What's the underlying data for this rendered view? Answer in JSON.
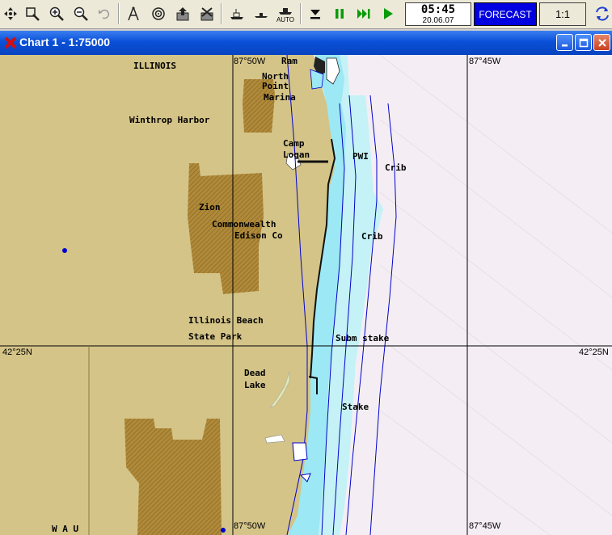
{
  "toolbar": {
    "tools": [
      {
        "icon": "move-icon"
      },
      {
        "icon": "zoom-window-icon"
      },
      {
        "icon": "zoom-in-icon"
      },
      {
        "icon": "zoom-out-icon"
      },
      {
        "icon": "undo-icon"
      },
      {
        "icon": "compass-icon"
      },
      {
        "icon": "target-icon"
      },
      {
        "icon": "export-icon"
      },
      {
        "icon": "clear-icon"
      },
      {
        "icon": "ship-dock-icon"
      },
      {
        "icon": "ship-icon"
      },
      {
        "icon": "auto-ship-icon",
        "label": "AUTO"
      },
      {
        "icon": "download-icon"
      },
      {
        "icon": "pause-icon"
      },
      {
        "icon": "fast-forward-icon"
      },
      {
        "icon": "play-icon"
      }
    ],
    "clock_time": "05:45",
    "clock_date": "20.06.07",
    "forecast_label": "FORECAST",
    "scale_label": "1:1",
    "sync_icon": "sync-icon"
  },
  "window": {
    "title": "Chart 1 - 1:75000",
    "icon": "app-logo-icon",
    "buttons": [
      "minimize-icon",
      "maximize-icon",
      "close-icon"
    ]
  },
  "chart": {
    "colors": {
      "land": "#d4c488",
      "urban": "#b08a3a",
      "shallow": "#9ce8f4",
      "medium": "#c4f2f6",
      "deep": "#f4eef4",
      "grid": "#000000",
      "depth_contour": "#0000cc"
    },
    "coords": {
      "lon_top_left": "87°50W",
      "lon_top_right": "87°45W",
      "lat_left": "42°25N",
      "lat_right": "42°25N",
      "lon_bottom_left": "87°50W",
      "lon_bottom_right": "87°45W"
    },
    "labels": {
      "illinois": "ILLINOIS",
      "ram": "Ram",
      "north": "North",
      "point": "Point",
      "marina": "Marina",
      "winthrop": "Winthrop Harbor",
      "camp": "Camp",
      "logan": "Logan",
      "pwi": "PWI",
      "crib1": "Crib",
      "zion": "Zion",
      "commonwealth": "Commonwealth",
      "edison": "Edison Co",
      "crib2": "Crib",
      "illinois_beach": "Illinois Beach",
      "state_park": "State Park",
      "subm_stake": "Subm stake",
      "dead": "Dead",
      "lake": "Lake",
      "stake": "Stake",
      "wau": "W A U"
    }
  }
}
